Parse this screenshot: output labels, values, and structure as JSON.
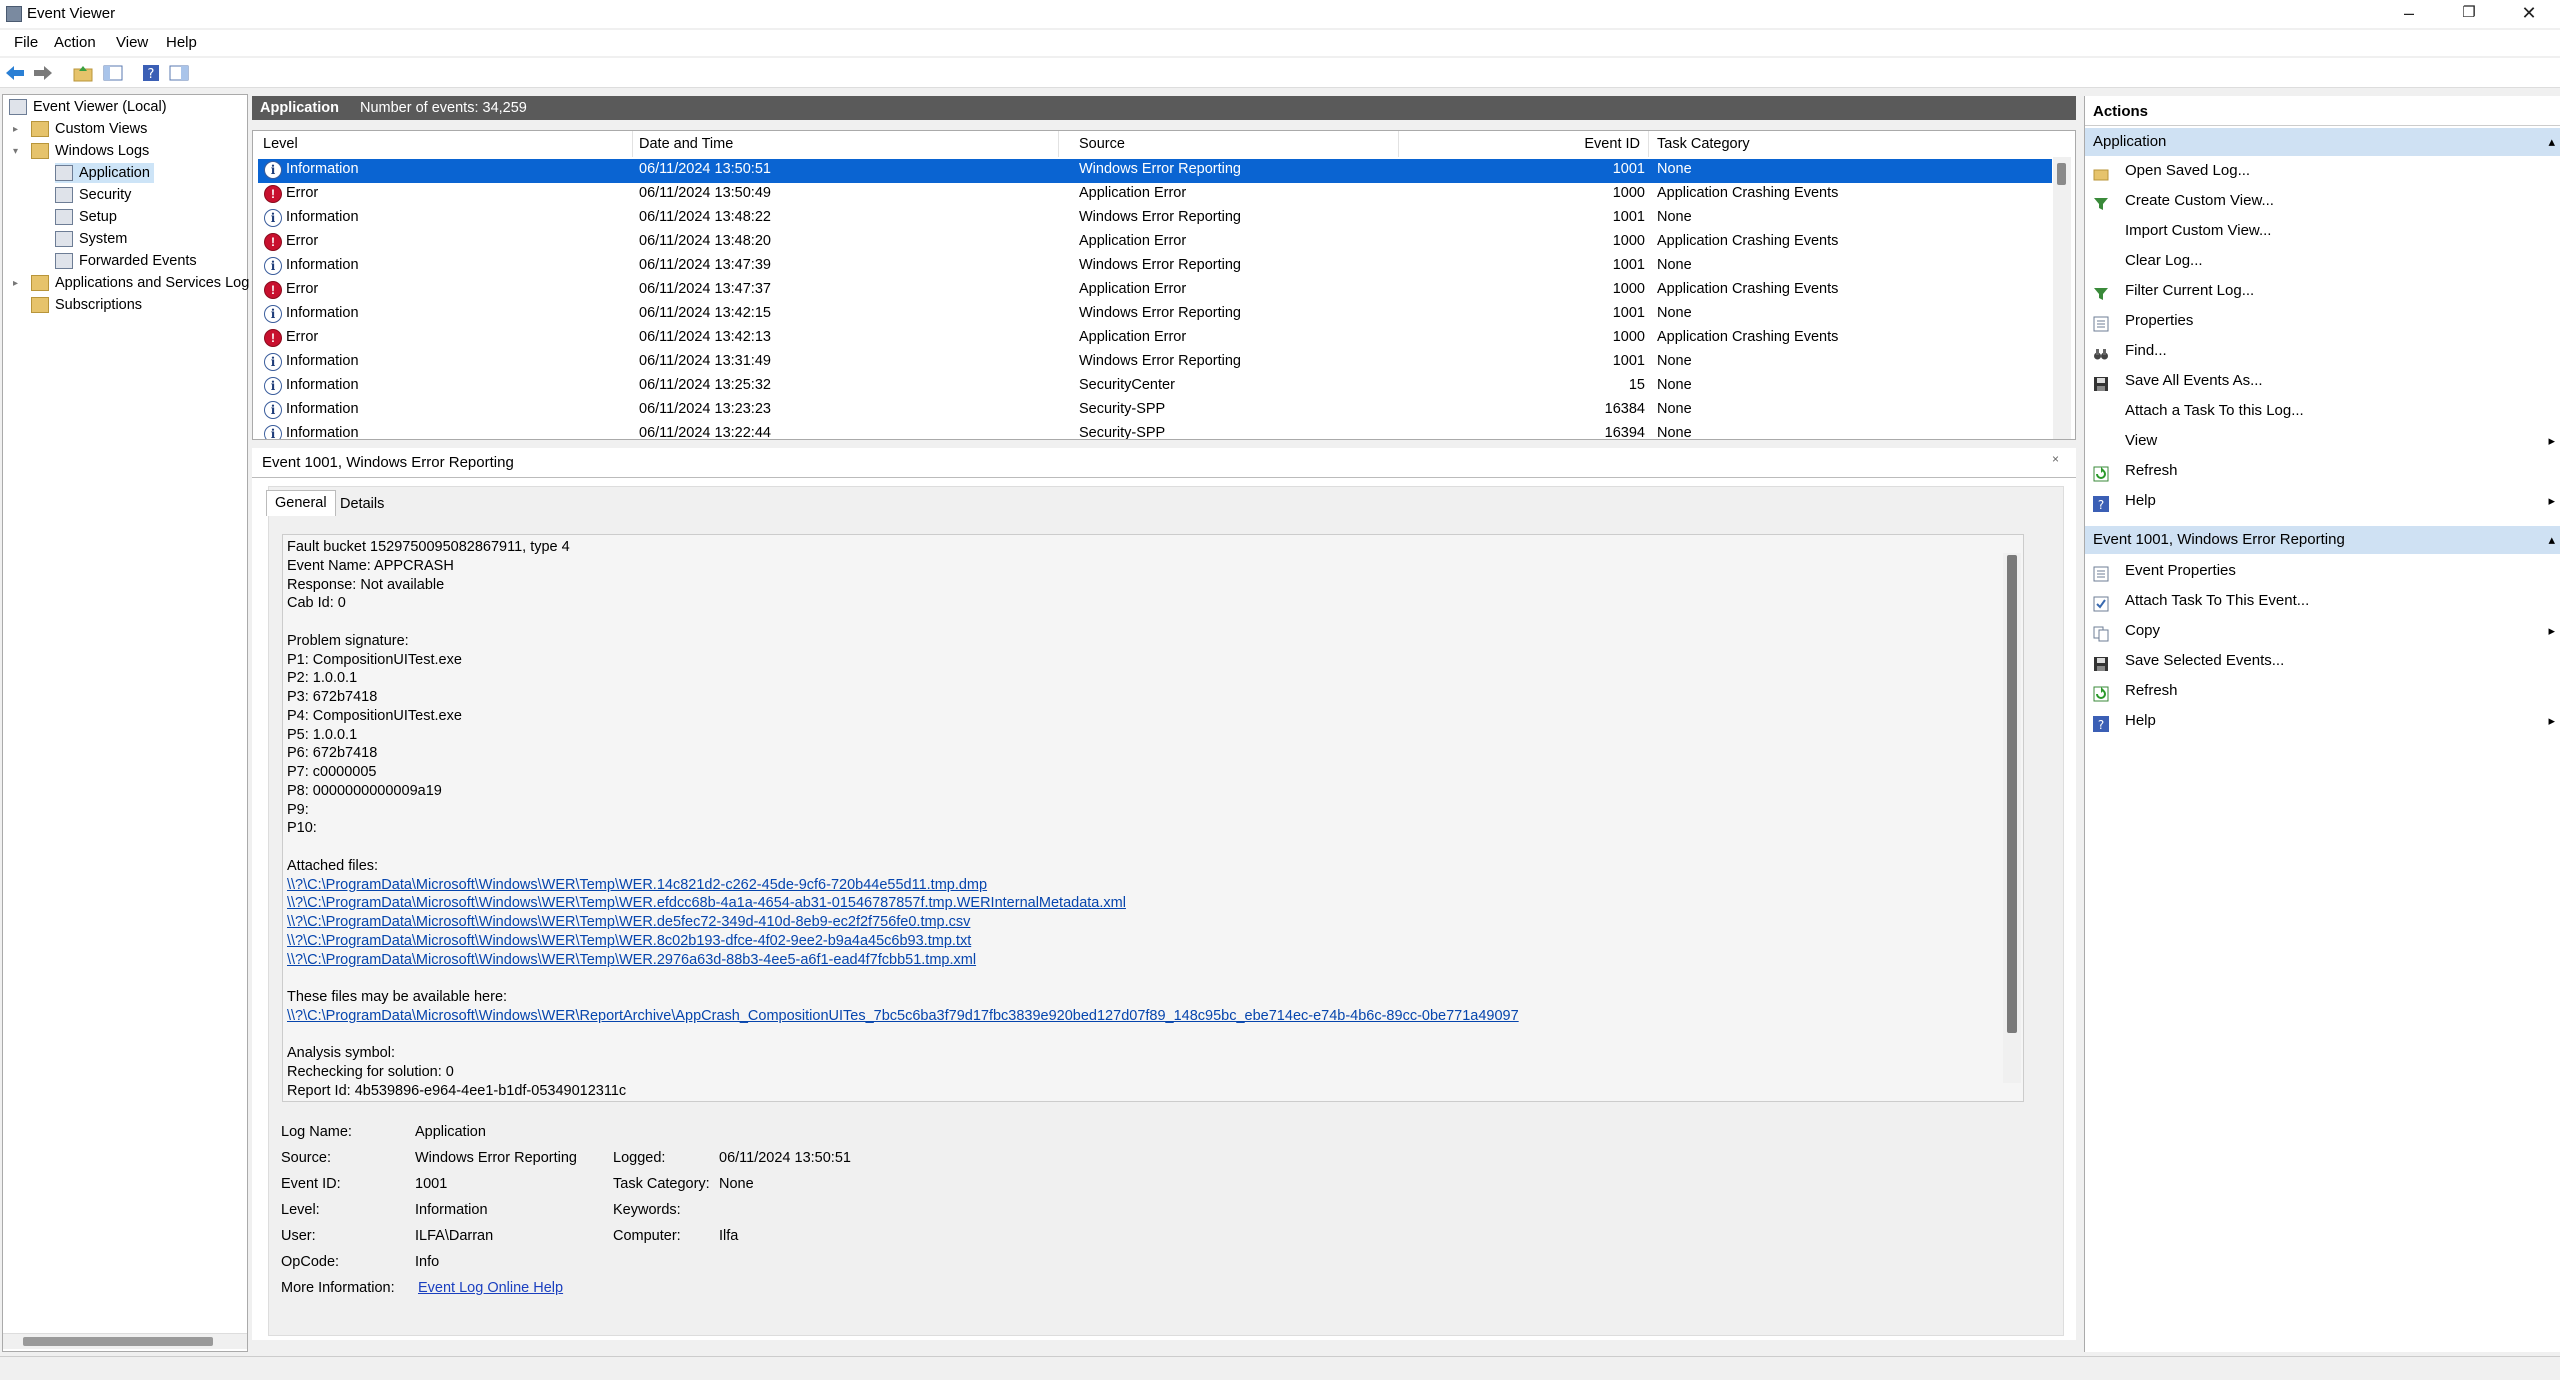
{
  "window": {
    "title": "Event Viewer"
  },
  "menu": [
    "File",
    "Action",
    "View",
    "Help"
  ],
  "tree": {
    "root": "Event Viewer (Local)",
    "custom_views": "Custom Views",
    "windows_logs": "Windows Logs",
    "application": "Application",
    "security": "Security",
    "setup": "Setup",
    "system": "System",
    "forwarded": "Forwarded Events",
    "apps_services": "Applications and Services Log",
    "subscriptions": "Subscriptions"
  },
  "center_header": {
    "log_name": "Application",
    "count_text": "Number of events: 34,259"
  },
  "columns": {
    "level": "Level",
    "datetime": "Date and Time",
    "source": "Source",
    "event_id": "Event ID",
    "task_category": "Task Category"
  },
  "events": [
    {
      "type": "info",
      "level": "Information",
      "datetime": "06/11/2024 13:50:51",
      "source": "Windows Error Reporting",
      "event_id": "1001",
      "task": "None"
    },
    {
      "type": "error",
      "level": "Error",
      "datetime": "06/11/2024 13:50:49",
      "source": "Application Error",
      "event_id": "1000",
      "task": "Application Crashing Events"
    },
    {
      "type": "info",
      "level": "Information",
      "datetime": "06/11/2024 13:48:22",
      "source": "Windows Error Reporting",
      "event_id": "1001",
      "task": "None"
    },
    {
      "type": "error",
      "level": "Error",
      "datetime": "06/11/2024 13:48:20",
      "source": "Application Error",
      "event_id": "1000",
      "task": "Application Crashing Events"
    },
    {
      "type": "info",
      "level": "Information",
      "datetime": "06/11/2024 13:47:39",
      "source": "Windows Error Reporting",
      "event_id": "1001",
      "task": "None"
    },
    {
      "type": "error",
      "level": "Error",
      "datetime": "06/11/2024 13:47:37",
      "source": "Application Error",
      "event_id": "1000",
      "task": "Application Crashing Events"
    },
    {
      "type": "info",
      "level": "Information",
      "datetime": "06/11/2024 13:42:15",
      "source": "Windows Error Reporting",
      "event_id": "1001",
      "task": "None"
    },
    {
      "type": "error",
      "level": "Error",
      "datetime": "06/11/2024 13:42:13",
      "source": "Application Error",
      "event_id": "1000",
      "task": "Application Crashing Events"
    },
    {
      "type": "info",
      "level": "Information",
      "datetime": "06/11/2024 13:31:49",
      "source": "Windows Error Reporting",
      "event_id": "1001",
      "task": "None"
    },
    {
      "type": "info",
      "level": "Information",
      "datetime": "06/11/2024 13:25:32",
      "source": "SecurityCenter",
      "event_id": "15",
      "task": "None"
    },
    {
      "type": "info",
      "level": "Information",
      "datetime": "06/11/2024 13:23:23",
      "source": "Security-SPP",
      "event_id": "16384",
      "task": "None"
    },
    {
      "type": "info",
      "level": "Information",
      "datetime": "06/11/2024 13:22:44",
      "source": "Security-SPP",
      "event_id": "16394",
      "task": "None"
    }
  ],
  "detail": {
    "title": "Event 1001, Windows Error Reporting",
    "tabs": {
      "general": "General",
      "details": "Details"
    },
    "description": [
      {
        "text": "Fault bucket 1529750095082867911, type 4",
        "link": false
      },
      {
        "text": "Event Name: APPCRASH",
        "link": false
      },
      {
        "text": "Response: Not available",
        "link": false
      },
      {
        "text": "Cab Id: 0",
        "link": false
      },
      {
        "text": "",
        "link": false
      },
      {
        "text": "Problem signature:",
        "link": false
      },
      {
        "text": "P1: CompositionUITest.exe",
        "link": false
      },
      {
        "text": "P2: 1.0.0.1",
        "link": false
      },
      {
        "text": "P3: 672b7418",
        "link": false
      },
      {
        "text": "P4: CompositionUITest.exe",
        "link": false
      },
      {
        "text": "P5: 1.0.0.1",
        "link": false
      },
      {
        "text": "P6: 672b7418",
        "link": false
      },
      {
        "text": "P7: c0000005",
        "link": false
      },
      {
        "text": "P8: 0000000000009a19",
        "link": false
      },
      {
        "text": "P9:",
        "link": false
      },
      {
        "text": "P10:",
        "link": false
      },
      {
        "text": "",
        "link": false
      },
      {
        "text": "Attached files:",
        "link": false
      },
      {
        "text": "\\\\?\\C:\\ProgramData\\Microsoft\\Windows\\WER\\Temp\\WER.14c821d2-c262-45de-9cf6-720b44e55d11.tmp.dmp",
        "link": true
      },
      {
        "text": "\\\\?\\C:\\ProgramData\\Microsoft\\Windows\\WER\\Temp\\WER.efdcc68b-4a1a-4654-ab31-01546787857f.tmp.WERInternalMetadata.xml",
        "link": true
      },
      {
        "text": "\\\\?\\C:\\ProgramData\\Microsoft\\Windows\\WER\\Temp\\WER.de5fec72-349d-410d-8eb9-ec2f2f756fe0.tmp.csv",
        "link": true
      },
      {
        "text": "\\\\?\\C:\\ProgramData\\Microsoft\\Windows\\WER\\Temp\\WER.8c02b193-dfce-4f02-9ee2-b9a4a45c6b93.tmp.txt",
        "link": true
      },
      {
        "text": "\\\\?\\C:\\ProgramData\\Microsoft\\Windows\\WER\\Temp\\WER.2976a63d-88b3-4ee5-a6f1-ead4f7fcbb51.tmp.xml",
        "link": true
      },
      {
        "text": "",
        "link": false
      },
      {
        "text": "These files may be available here:",
        "link": false
      },
      {
        "text": "\\\\?\\C:\\ProgramData\\Microsoft\\Windows\\WER\\ReportArchive\\AppCrash_CompositionUITes_7bc5c6ba3f79d17fbc3839e920bed127d07f89_148c95bc_ebe714ec-e74b-4b6c-89cc-0be771a49097",
        "link": true
      },
      {
        "text": "",
        "link": false
      },
      {
        "text": "Analysis symbol:",
        "link": false
      },
      {
        "text": "Rechecking for solution: 0",
        "link": false
      },
      {
        "text": "Report Id: 4b539896-e964-4ee1-b1df-05349012311c",
        "link": false
      }
    ],
    "props": {
      "log_name_label": "Log Name:",
      "log_name": "Application",
      "source_label": "Source:",
      "source": "Windows Error Reporting",
      "logged_label": "Logged:",
      "logged": "06/11/2024 13:50:51",
      "event_id_label": "Event ID:",
      "event_id": "1001",
      "task_label": "Task Category:",
      "task": "None",
      "level_label": "Level:",
      "level": "Information",
      "keywords_label": "Keywords:",
      "user_label": "User:",
      "user": "ILFA\\Darran",
      "computer_label": "Computer:",
      "computer": "Ilfa",
      "opcode_label": "OpCode:",
      "opcode": "Info",
      "more_info_label": "More Information:",
      "more_info_link": "Event Log Online Help"
    }
  },
  "actions": {
    "header": "Actions",
    "section1_title": "Application",
    "section1_items": [
      {
        "label": "Open Saved Log...",
        "icon": "folder-open-icon",
        "arrow": ""
      },
      {
        "label": "Create Custom View...",
        "icon": "filter-icon",
        "arrow": ""
      },
      {
        "label": "Import Custom View...",
        "icon": "",
        "arrow": ""
      },
      {
        "label": "Clear Log...",
        "icon": "",
        "arrow": ""
      },
      {
        "label": "Filter Current Log...",
        "icon": "filter-icon",
        "arrow": ""
      },
      {
        "label": "Properties",
        "icon": "properties-icon",
        "arrow": ""
      },
      {
        "label": "Find...",
        "icon": "binoculars-icon",
        "arrow": ""
      },
      {
        "label": "Save All Events As...",
        "icon": "save-icon",
        "arrow": ""
      },
      {
        "label": "Attach a Task To this Log...",
        "icon": "",
        "arrow": ""
      },
      {
        "label": "View",
        "icon": "",
        "arrow": "▸"
      },
      {
        "label": "Refresh",
        "icon": "refresh-icon",
        "arrow": ""
      },
      {
        "label": "Help",
        "icon": "help-icon",
        "arrow": "▸"
      }
    ],
    "section2_title": "Event 1001, Windows Error Reporting",
    "section2_items": [
      {
        "label": "Event Properties",
        "icon": "properties-icon",
        "arrow": ""
      },
      {
        "label": "Attach Task To This Event...",
        "icon": "task-icon",
        "arrow": ""
      },
      {
        "label": "Copy",
        "icon": "copy-icon",
        "arrow": "▸"
      },
      {
        "label": "Save Selected Events...",
        "icon": "save-icon",
        "arrow": ""
      },
      {
        "label": "Refresh",
        "icon": "refresh-icon",
        "arrow": ""
      },
      {
        "label": "Help",
        "icon": "help-icon",
        "arrow": "▸"
      }
    ]
  },
  "colors": {
    "selection": "#0a64d2",
    "section_header": "#cfe1f3",
    "link": "#0645ad",
    "error": "#c8102e"
  }
}
